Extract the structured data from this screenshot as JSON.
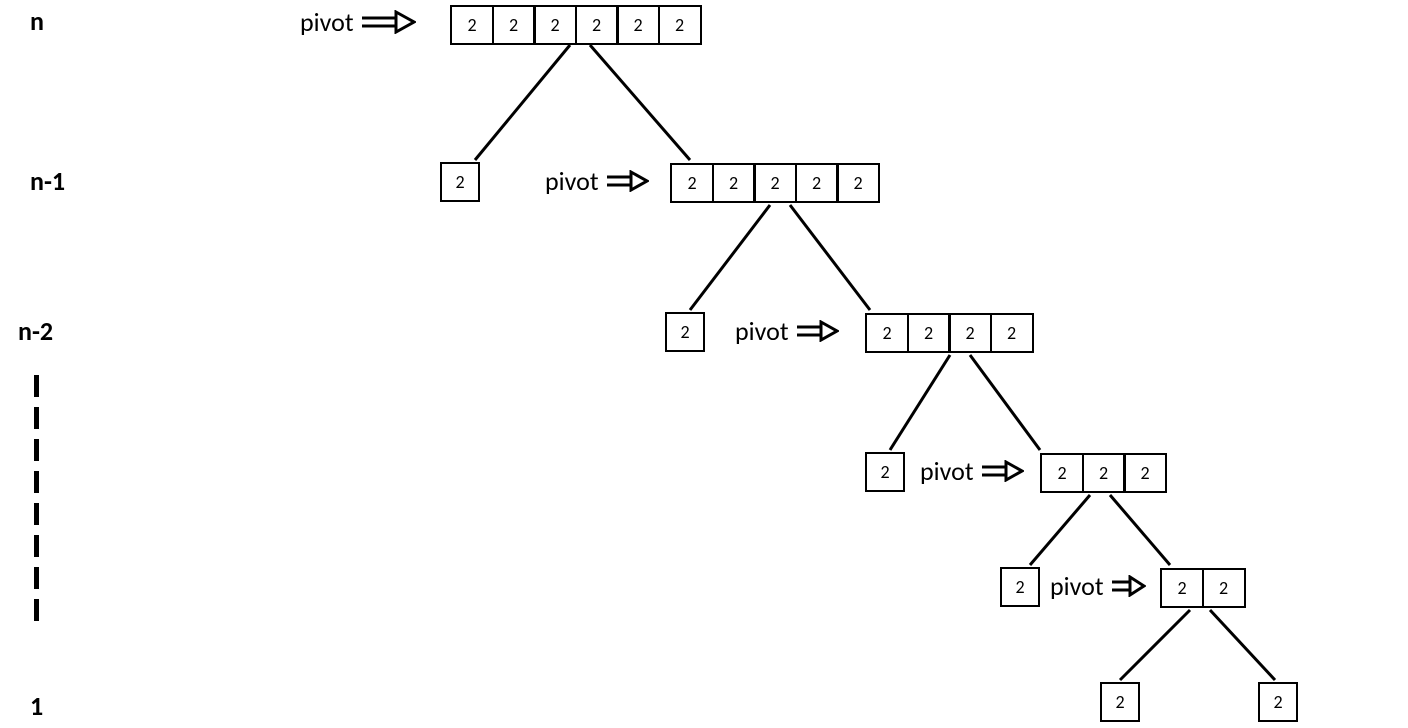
{
  "labels": {
    "n": "n",
    "n1": "n-1",
    "n2": "n-2",
    "one": "1",
    "pivot": "pivot"
  },
  "level0": {
    "cells": [
      "2",
      "2",
      "2",
      "2",
      "2",
      "2"
    ]
  },
  "level1": {
    "single": "2",
    "cells": [
      "2",
      "2",
      "2",
      "2",
      "2"
    ]
  },
  "level2": {
    "single": "2",
    "cells": [
      "2",
      "2",
      "2",
      "2"
    ]
  },
  "level3": {
    "single": "2",
    "cells": [
      "2",
      "2",
      "2"
    ]
  },
  "level4": {
    "single": "2",
    "cells": [
      "2",
      "2"
    ]
  },
  "level5": {
    "left": "2",
    "right": "2"
  }
}
